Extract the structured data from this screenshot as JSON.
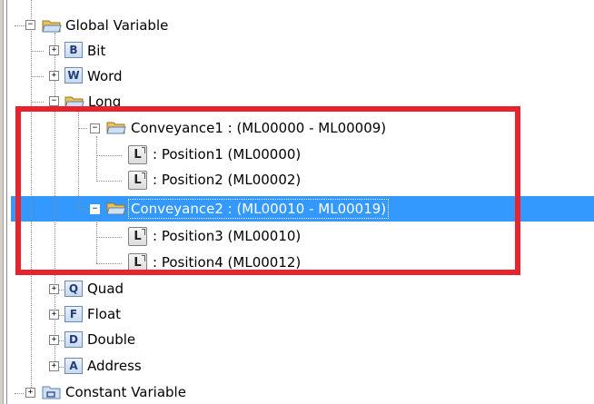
{
  "tree": {
    "global_variable": {
      "label": "Global Variable",
      "expander": "−"
    },
    "bit": {
      "label": "Bit",
      "type_letter": "B",
      "expander": "+"
    },
    "word": {
      "label": "Word",
      "type_letter": "W",
      "expander": "+"
    },
    "long": {
      "label": "Long",
      "expander": "−"
    },
    "conveyance1": {
      "label": "Conveyance1 : (ML00000 - ML00009)",
      "expander": "−"
    },
    "position1": {
      "label": ": Position1 (ML00000)",
      "type_letter": "L"
    },
    "position2": {
      "label": ": Position2 (ML00002)",
      "type_letter": "L"
    },
    "conveyance2": {
      "label": "Conveyance2 : (ML00010 - ML00019)",
      "expander": "−"
    },
    "position3": {
      "label": ": Position3 (ML00010)",
      "type_letter": "L"
    },
    "position4": {
      "label": ": Position4 (ML00012)",
      "type_letter": "L"
    },
    "quad": {
      "label": "Quad",
      "type_letter": "Q",
      "expander": "+"
    },
    "float": {
      "label": "Float",
      "type_letter": "F",
      "expander": "+"
    },
    "double": {
      "label": "Double",
      "type_letter": "D",
      "expander": "+"
    },
    "address": {
      "label": "Address",
      "type_letter": "A",
      "expander": "+"
    },
    "constant_variable": {
      "label": "Constant Variable",
      "expander": "+"
    }
  },
  "colors": {
    "selection": "#3399ff",
    "highlight_box": "#e8232d",
    "folder": "#e8c25a",
    "type_icon": "#1f3f7a"
  },
  "icons": {
    "folder": "folder-open-icon",
    "constant": "constant-folder-icon",
    "type": "data-type-icon",
    "long_item": "long-variable-icon"
  }
}
